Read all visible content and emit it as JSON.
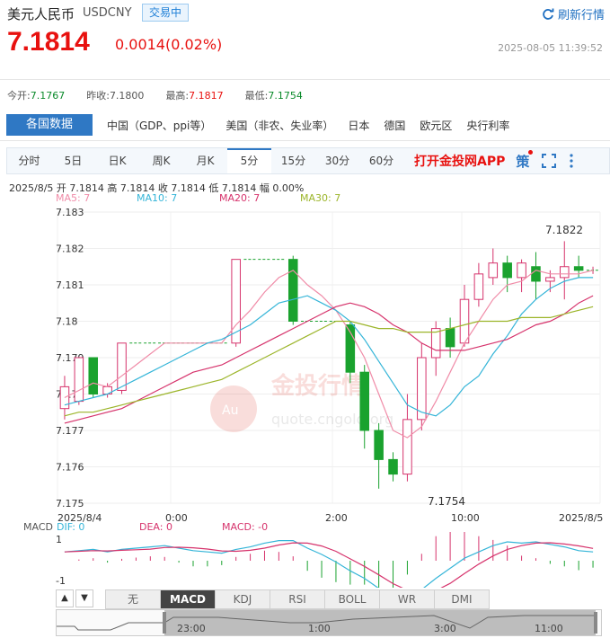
{
  "header": {
    "title": "美元人民币",
    "symbol": "USDCNY",
    "badge": "交易中",
    "refresh_label": "刷新行情",
    "price": "7.1814",
    "change": "0.0014(0.02%)",
    "timestamp": "2025-08-05 11:39:52"
  },
  "stats": [
    {
      "label": "今开:",
      "value": "7.1767",
      "color": "green"
    },
    {
      "label": "昨收:",
      "value": "7.1800",
      "color": "plain"
    },
    {
      "label": "最高:",
      "value": "7.1817",
      "color": "red"
    },
    {
      "label": "最低:",
      "value": "7.1754",
      "color": "green"
    }
  ],
  "categories": {
    "active": "各国数据",
    "items": [
      "中国（GDP、ppi等）",
      "美国（非农、失业率）",
      "日本",
      "德国",
      "欧元区",
      "央行利率"
    ]
  },
  "tabs": {
    "items": [
      "分时",
      "5日",
      "日K",
      "周K",
      "月K",
      "5分",
      "15分",
      "30分",
      "60分"
    ],
    "active_index": 5,
    "app_link": "打开金投网APP",
    "tool_icon_label": "策"
  },
  "ohlc": {
    "date": "2025/8/5",
    "open_label": "开",
    "open": "7.1814",
    "high_label": "高",
    "high": "7.1814",
    "close_label": "收",
    "close": "7.1814",
    "low_label": "低",
    "low": "7.1814",
    "amp_label": "幅",
    "amp": "0.00%"
  },
  "ma": [
    {
      "label": "MA5: 7",
      "color": "#f08ca8"
    },
    {
      "label": "MA10: 7",
      "color": "#35b5d8"
    },
    {
      "label": "MA20: 7",
      "color": "#d6336c"
    },
    {
      "label": "MA30: 7",
      "color": "#9cb52a"
    }
  ],
  "watermark": {
    "brand": "金投行情",
    "url": "quote.cngold.org",
    "logo": "Au"
  },
  "macd": {
    "title": "MACD",
    "dif": "DIF: 0",
    "dea": "DEA: 0",
    "macd": "MACD: -0",
    "top": "1",
    "bottom": "-1"
  },
  "indicators": {
    "items": [
      "无",
      "MACD",
      "KDJ",
      "RSI",
      "BOLL",
      "WR",
      "DMI"
    ],
    "active_index": 1
  },
  "navigator": {
    "labels": [
      "23:00",
      "1:00",
      "3:00",
      "11:00"
    ]
  },
  "chart_data": {
    "type": "candlestick",
    "y_ticks": [
      "7.183",
      "7.182",
      "7.181",
      "7.18",
      "7.179",
      "7.178",
      "7.177",
      "7.176",
      "7.175"
    ],
    "ylim": [
      7.175,
      7.183
    ],
    "x_labels": [
      "2025/8/4",
      "0:00",
      "2:00",
      "10:00",
      "2025/8/5"
    ],
    "annotations": {
      "max": "7.1822",
      "min": "7.1754"
    },
    "candles": [
      [
        7.1776,
        7.1782,
        7.1785,
        7.1773
      ],
      [
        7.1778,
        7.179,
        7.179,
        7.1777
      ],
      [
        7.179,
        7.178,
        7.179,
        7.1779
      ],
      [
        7.178,
        7.1782,
        7.1783,
        7.1779
      ],
      [
        7.1781,
        7.1794,
        7.1794,
        7.178
      ],
      [
        7.1794,
        7.1794,
        7.1794,
        7.1794
      ],
      [
        7.1794,
        7.1794,
        7.1794,
        7.1794
      ],
      [
        7.1794,
        7.1794,
        7.1794,
        7.1794
      ],
      [
        7.1794,
        7.1794,
        7.1794,
        7.1794
      ],
      [
        7.1794,
        7.1794,
        7.1794,
        7.1794
      ],
      [
        7.1794,
        7.1794,
        7.1794,
        7.1794
      ],
      [
        7.1794,
        7.1794,
        7.1794,
        7.1794
      ],
      [
        7.1794,
        7.1817,
        7.1817,
        7.1793
      ],
      [
        7.1817,
        7.1817,
        7.1817,
        7.1817
      ],
      [
        7.1817,
        7.1817,
        7.1817,
        7.1817
      ],
      [
        7.1817,
        7.1817,
        7.1817,
        7.1817
      ],
      [
        7.1817,
        7.18,
        7.1818,
        7.1799
      ],
      [
        7.18,
        7.18,
        7.18,
        7.18
      ],
      [
        7.18,
        7.18,
        7.18,
        7.18
      ],
      [
        7.18,
        7.18,
        7.18,
        7.18
      ],
      [
        7.1799,
        7.1786,
        7.18,
        7.1783
      ],
      [
        7.1786,
        7.177,
        7.1788,
        7.1765
      ],
      [
        7.177,
        7.1762,
        7.1772,
        7.1754
      ],
      [
        7.1762,
        7.1758,
        7.1764,
        7.1756
      ],
      [
        7.1758,
        7.1773,
        7.178,
        7.1756
      ],
      [
        7.1773,
        7.179,
        7.1794,
        7.177
      ],
      [
        7.179,
        7.1798,
        7.18,
        7.1785
      ],
      [
        7.1798,
        7.1793,
        7.1801,
        7.179
      ],
      [
        7.1794,
        7.1806,
        7.181,
        7.1793
      ],
      [
        7.1806,
        7.1813,
        7.1816,
        7.1804
      ],
      [
        7.1812,
        7.1816,
        7.182,
        7.181
      ],
      [
        7.1816,
        7.1812,
        7.1818,
        7.1808
      ],
      [
        7.1812,
        7.1816,
        7.1817,
        7.1808
      ],
      [
        7.1815,
        7.1811,
        7.1819,
        7.1806
      ],
      [
        7.1811,
        7.1812,
        7.1814,
        7.1808
      ],
      [
        7.1812,
        7.1815,
        7.1822,
        7.1806
      ],
      [
        7.1815,
        7.1814,
        7.1818,
        7.1812
      ],
      [
        7.1814,
        7.1814,
        7.1815,
        7.1813
      ]
    ],
    "ma5": [
      7.1779,
      7.1781,
      7.1783,
      7.1782,
      7.1785,
      7.1788,
      7.1791,
      7.1794,
      7.1794,
      7.1794,
      7.1794,
      7.1794,
      7.1799,
      7.1803,
      7.1808,
      7.1812,
      7.1814,
      7.181,
      7.1807,
      7.1803,
      7.1797,
      7.179,
      7.178,
      7.177,
      7.1768,
      7.1771,
      7.1778,
      7.1786,
      7.1794,
      7.18,
      7.1806,
      7.181,
      7.1811,
      7.1814,
      7.1813,
      7.1813,
      7.1813,
      7.1814
    ],
    "ma10": [
      7.1777,
      7.1778,
      7.1779,
      7.178,
      7.1782,
      7.1784,
      7.1786,
      7.1788,
      7.179,
      7.1792,
      7.1794,
      7.1795,
      7.1797,
      7.1799,
      7.1802,
      7.1805,
      7.1806,
      7.1807,
      7.1805,
      7.1803,
      7.18,
      7.1795,
      7.1789,
      7.1783,
      7.1777,
      7.1775,
      7.1774,
      7.1777,
      7.1782,
      7.1785,
      7.1791,
      7.1796,
      7.1802,
      7.1806,
      7.1809,
      7.1811,
      7.1812,
      7.1812
    ],
    "ma20": [
      7.1772,
      7.1773,
      7.1774,
      7.1775,
      7.1776,
      7.1778,
      7.178,
      7.1782,
      7.1784,
      7.1786,
      7.1787,
      7.1788,
      7.179,
      7.1792,
      7.1794,
      7.1796,
      7.1798,
      7.18,
      7.1802,
      7.1804,
      7.1805,
      7.1804,
      7.1802,
      7.1799,
      7.1797,
      7.1794,
      7.1792,
      7.1792,
      7.1792,
      7.1793,
      7.1794,
      7.1795,
      7.1797,
      7.1799,
      7.18,
      7.1802,
      7.1805,
      7.1807
    ],
    "ma30": [
      7.1774,
      7.1775,
      7.1775,
      7.1776,
      7.1777,
      7.1778,
      7.1779,
      7.178,
      7.1781,
      7.1782,
      7.1783,
      7.1784,
      7.1786,
      7.1788,
      7.179,
      7.1792,
      7.1794,
      7.1796,
      7.1798,
      7.18,
      7.18,
      7.1799,
      7.1798,
      7.1798,
      7.1797,
      7.1797,
      7.1797,
      7.1798,
      7.1799,
      7.18,
      7.18,
      7.18,
      7.1801,
      7.1801,
      7.1801,
      7.1802,
      7.1803,
      7.1804
    ]
  }
}
